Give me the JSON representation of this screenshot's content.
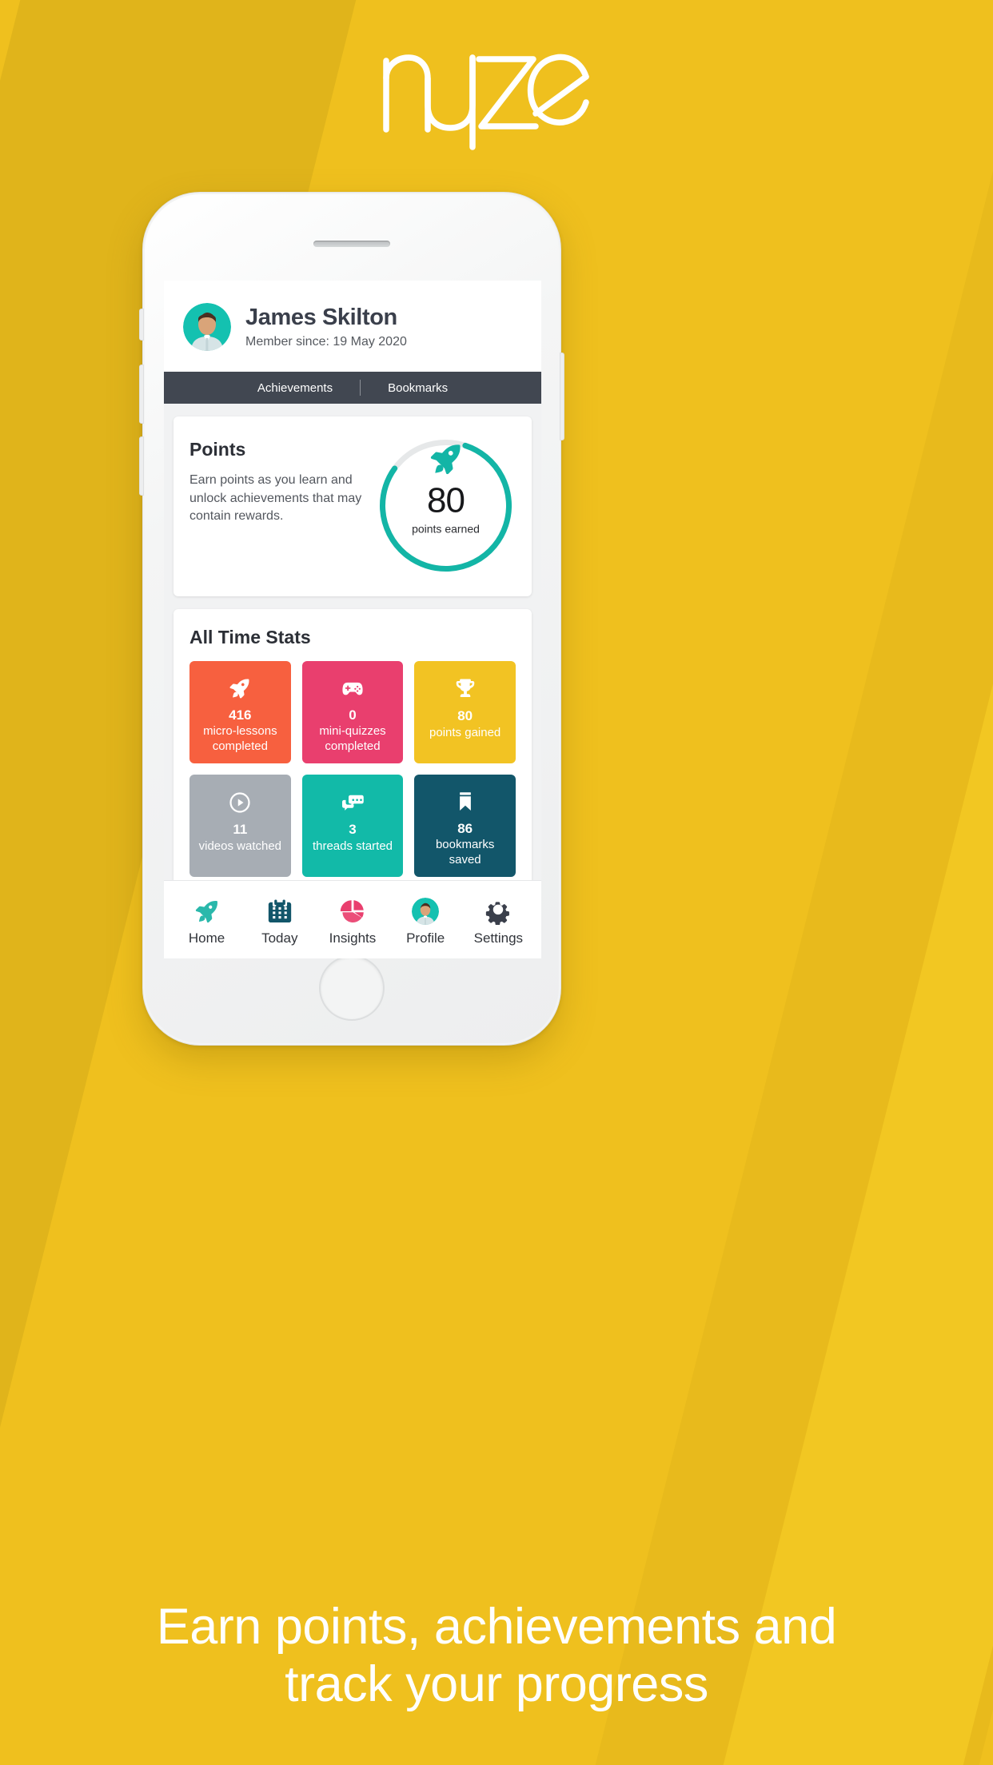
{
  "brand": {
    "logo_text": "ryze",
    "background_color": "#EFC01E"
  },
  "tagline": {
    "line1": "Earn points, achievements and",
    "line2": "track your progress"
  },
  "screen": {
    "profile": {
      "name": "James Skilton",
      "member_since": "Member since: 19 May 2020",
      "avatar_icon": "user-avatar"
    },
    "tabs": [
      {
        "label": "Achievements",
        "active": true
      },
      {
        "label": "Bookmarks",
        "active": false
      }
    ],
    "points_card": {
      "title": "Points",
      "description": "Earn points as you learn and unlock achievements that may contain rewards.",
      "ring_icon": "rocket-icon",
      "value": "80",
      "label": "points earned",
      "percent": 80,
      "track_color": "#E6E8E9",
      "progress_color": "#13B5A6"
    },
    "stats_card": {
      "title": "All Time Stats",
      "tiles": [
        {
          "icon": "rocket-icon",
          "value": "416",
          "label": "micro-lessons\ncompleted",
          "color": "#F7603F"
        },
        {
          "icon": "gamepad-icon",
          "value": "0",
          "label": "mini-quizzes\ncompleted",
          "color": "#E93F6E"
        },
        {
          "icon": "trophy-icon",
          "value": "80",
          "label": "points gained",
          "color": "#F2C323"
        },
        {
          "icon": "play-icon",
          "value": "11",
          "label": "videos watched",
          "color": "#A7ADB4"
        },
        {
          "icon": "chat-icon",
          "value": "3",
          "label": "threads started",
          "color": "#12BAA8"
        },
        {
          "icon": "bookmark-icon",
          "value": "86",
          "label": "bookmarks\nsaved",
          "color": "#12566A"
        }
      ]
    },
    "bottom_nav": [
      {
        "label": "Home",
        "icon": "rocket-icon",
        "color": "#2AB8AB"
      },
      {
        "label": "Today",
        "icon": "calendar-icon",
        "color": "#12566A"
      },
      {
        "label": "Insights",
        "icon": "pie-chart-icon",
        "color": "#E93F6E"
      },
      {
        "label": "Profile",
        "icon": "avatar-icon",
        "color": "#12BAA8"
      },
      {
        "label": "Settings",
        "icon": "gear-icon",
        "color": "#3A3F4B"
      }
    ]
  }
}
